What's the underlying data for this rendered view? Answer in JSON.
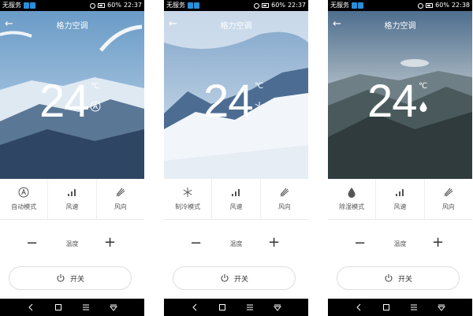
{
  "phones": [
    {
      "status": {
        "carrier": "无服务",
        "battery": "60%",
        "time": "22:37"
      },
      "title": "格力空调",
      "temperature": "24",
      "unit": "℃",
      "mode_icon": "auto-a-icon",
      "options": [
        {
          "label": "自动模式",
          "icon": "auto-a-icon"
        },
        {
          "label": "风速",
          "icon": "fan-speed-bars-icon"
        },
        {
          "label": "风向",
          "icon": "wind-direction-icon"
        }
      ],
      "temp_label": "温度",
      "minus": "−",
      "plus": "+",
      "power_label": "开关"
    },
    {
      "status": {
        "carrier": "无服务",
        "battery": "60%",
        "time": "22:37"
      },
      "title": "格力空调",
      "temperature": "24",
      "unit": "℃",
      "mode_icon": "snowflake-icon",
      "options": [
        {
          "label": "制冷模式",
          "icon": "snowflake-icon"
        },
        {
          "label": "风速",
          "icon": "fan-speed-bars-icon"
        },
        {
          "label": "风向",
          "icon": "wind-direction-icon"
        }
      ],
      "temp_label": "温度",
      "minus": "−",
      "plus": "+",
      "power_label": "开关"
    },
    {
      "status": {
        "carrier": "无服务",
        "battery": "60%",
        "time": "22:38"
      },
      "title": "格力空调",
      "temperature": "24",
      "unit": "℃",
      "mode_icon": "water-drop-icon",
      "options": [
        {
          "label": "除湿模式",
          "icon": "water-drop-icon"
        },
        {
          "label": "风速",
          "icon": "fan-speed-bars-icon"
        },
        {
          "label": "风向",
          "icon": "wind-direction-icon"
        }
      ],
      "temp_label": "温度",
      "minus": "−",
      "plus": "+",
      "power_label": "开关"
    }
  ]
}
